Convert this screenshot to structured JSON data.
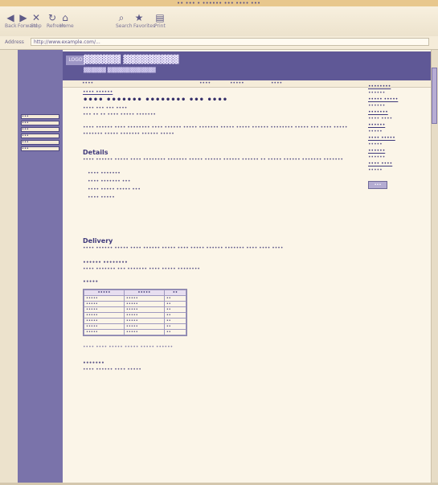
{
  "window": {
    "title": "•• ••• • •••••• ••• •••• •••",
    "toolbar": [
      {
        "icon": "back-icon",
        "label": "Back"
      },
      {
        "icon": "forward-icon",
        "label": "Forward"
      },
      {
        "icon": "stop-icon",
        "label": "Stop"
      },
      {
        "icon": "refresh-icon",
        "label": "Refresh"
      },
      {
        "icon": "home-icon",
        "label": "Home"
      },
      {
        "icon": "search-icon",
        "label": "Search"
      },
      {
        "icon": "favorites-icon",
        "label": "Favorites"
      },
      {
        "icon": "print-icon",
        "label": "Print"
      }
    ],
    "address_label": "Address",
    "address_value": "http://www.example.com/..."
  },
  "site": {
    "logo": "LOGO",
    "title": "▓▓▓▓▓▓ ▓▓▓▓▓▓▓▓▓",
    "subtitle": "▓▓▓▓▓▓ ▓▓▓▓▓▓▓▓▓▓▓▓▓"
  },
  "tabs": [
    "••••",
    "••••",
    "•••••",
    "••••"
  ],
  "left_nav": [
    "•••",
    "•••",
    "•••",
    "•••",
    "•••",
    "•••"
  ],
  "main": {
    "breadcrumb": "•••• ••••••",
    "title": "•••• ••••••• •••••••• ••• ••••",
    "meta1": "•••• ••• ••• ••••",
    "meta2": "••• •• •• •••• ••••• •••••••",
    "intro": "•••• •••••• •••• •••••••• •••• •••••• ••••• ••••••• ••••• ••••• •••••• •••••••• ••••• ••• •••• ••••• ••••••• ••••• ••••••• •••••• •••••",
    "details_heading": "Details",
    "details_text": "•••• •••••• ••••• •••• •••••••• ••••••• ••••• •••••• •••••• •••••• •• ••••• •••••• ••••••• •••••••",
    "bullets": [
      "•••• •••••••",
      "•••• ••••••• •••",
      "•••• ••••• ••••• •••",
      "•••• •••••"
    ],
    "section2_heading": "Delivery",
    "section2_text": "•••• •••••• ••••• •••• •••••• ••••• •••• ••••• •••••• ••••••• •••• •••• ••••",
    "subsection_heading": "•••••• ••••••••",
    "subsection_text": "•••• ••••••• ••• ••••••• •••• ••••• ••••••••",
    "table_heading": "•••••",
    "table_headers": [
      "•••••",
      "•••••",
      "••"
    ],
    "table_rows": [
      [
        "•••••",
        "•••••",
        "••"
      ],
      [
        "•••••",
        "•••••",
        "••"
      ],
      [
        "•••••",
        "•••••",
        "••"
      ],
      [
        "•••••",
        "•••••",
        "••"
      ],
      [
        "•••••",
        "•••••",
        "••"
      ],
      [
        "•••••",
        "•••••",
        "••"
      ],
      [
        "•••••",
        "•••••",
        "••"
      ]
    ],
    "footnote": "•••• •••• ••••• ••••• ••••• ••••••",
    "footer_heading": "•••••••",
    "footer_text": "•••• •••••• •••• •••••"
  },
  "right_col": {
    "items": [
      "••••••••",
      "••••••",
      "••••• •••••",
      "••••••",
      "•••••••",
      "•••• ••••",
      "••••••",
      "•••••",
      "•••• •••••",
      "•••••",
      "••••••",
      "••••••",
      "•••• ••••",
      "•••••"
    ],
    "button": "•••"
  }
}
